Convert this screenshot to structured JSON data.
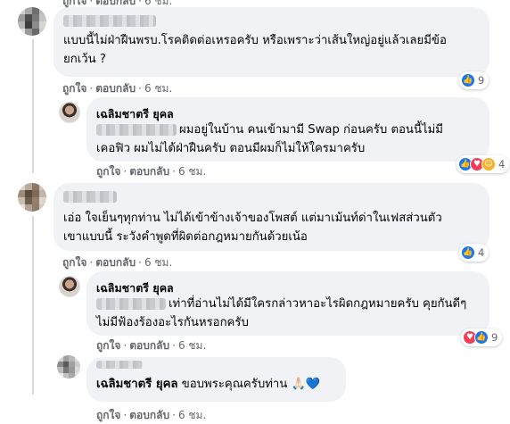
{
  "comments": [
    {
      "id": "c1",
      "text_lines": [
        "แบบนี้ไม่ฝ่าฝืนพรบ.โรคติดต่อเหรอครับ หรือเพราะว่าเส้นใหญ่อยู่แล้วเลยมีข้อ",
        "ยกเว้น ?"
      ],
      "actions": {
        "like": "ถูกใจ",
        "reply": "ตอบกลับ",
        "time": "6 ชม."
      },
      "reactions": {
        "icons": [
          "like-icon"
        ],
        "count": "9"
      }
    },
    {
      "id": "r1",
      "name": "เฉลิมชาตรี ยุคล",
      "text_lines": [
        "ผมอยู่ในบ้าน คนเข้ามามี Swap ก่อนครับ ตอนนี้ไม่มี",
        "เคอฟิว ผมไม่ได้ฝ่าฝืนครับ ตอนมีผมก็ไม่ให้ใครมาครับ"
      ],
      "actions": {
        "like": "ถูกใจ",
        "reply": "ตอบกลับ",
        "time": "6 ชม."
      },
      "reactions": {
        "icons": [
          "like-icon",
          "love-icon",
          "care-icon"
        ],
        "count": "4"
      }
    },
    {
      "id": "c2",
      "text_lines": [
        "เอ่อ ใจเย็นๆทุกท่าน ไม่ได้เข้าข้างเจ้าของโพสต์ แต่มาเม้นท์ด่าในเฟสส่วนตัว",
        "เขาแบบนี้ ระวังคำพูดที่ผิดต่อกฎหมายกันด้วยเน้อ"
      ],
      "actions": {
        "like": "ถูกใจ",
        "reply": "ตอบกลับ",
        "time": "6 ชม."
      },
      "reactions": {
        "icons": [
          "like-icon"
        ],
        "count": "4"
      }
    },
    {
      "id": "r2",
      "name": "เฉลิมชาตรี ยุคล",
      "text_lines": [
        "เท่าที่อ่านไม่ได้มีใครกล่าวหาอะไรผิดกฎหมายครับ คุยกันดีๆ",
        "ไม่มีฟ้องร้องอะไรกันหรอกครับ"
      ],
      "actions": {
        "like": "ถูกใจ",
        "reply": "ตอบกลับ",
        "time": "6 ชม."
      },
      "reactions": {
        "icons": [
          "love-icon",
          "like-icon"
        ],
        "count": "9"
      }
    },
    {
      "id": "r3",
      "mention": "เฉลิมชาตรี ยุคล",
      "text": "ขอบพระคุณครับท่าน 🙏🏻💙",
      "actions": {
        "like": "ถูกใจ",
        "reply": "ตอบกลับ",
        "time": "6 ชม."
      }
    }
  ],
  "top_actions": {
    "like": "ถูกใจ",
    "reply": "ตอบกลับ",
    "time": "6 ชม."
  }
}
